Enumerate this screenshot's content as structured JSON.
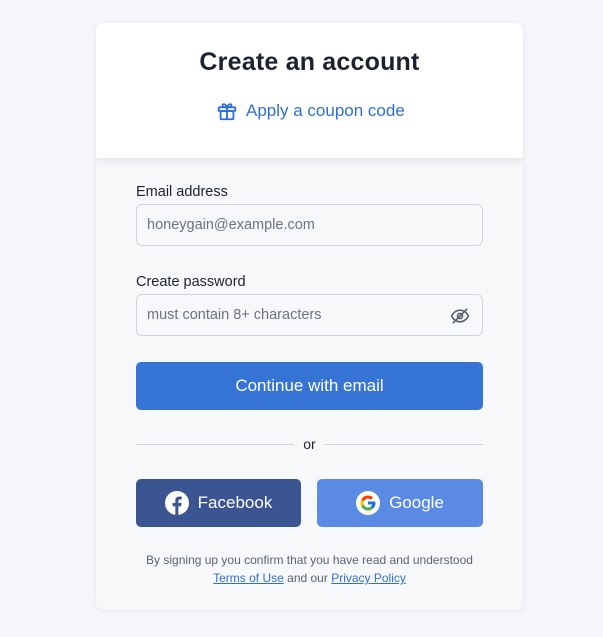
{
  "header": {
    "title": "Create an account",
    "coupon_label": "Apply a coupon code",
    "coupon_icon": "gift-icon"
  },
  "form": {
    "email_label": "Email address",
    "email_placeholder": "honeygain@example.com",
    "email_value": "",
    "password_label": "Create password",
    "password_placeholder": "must contain 8+ characters",
    "password_value": "",
    "toggle_icon": "eye-off-icon",
    "submit_label": "Continue with email"
  },
  "divider": {
    "text": "or"
  },
  "social": {
    "facebook_label": "Facebook",
    "facebook_icon": "facebook-icon",
    "google_label": "Google",
    "google_icon": "google-icon"
  },
  "legal": {
    "line1": "By signing up you confirm that you have read and understood",
    "terms_label": "Terms of Use",
    "connector": "and our",
    "privacy_label": "Privacy Policy"
  },
  "colors": {
    "accent": "#3574d4",
    "link": "#2f6fd0",
    "facebook": "#3b5593",
    "google": "#5b8ae4"
  }
}
